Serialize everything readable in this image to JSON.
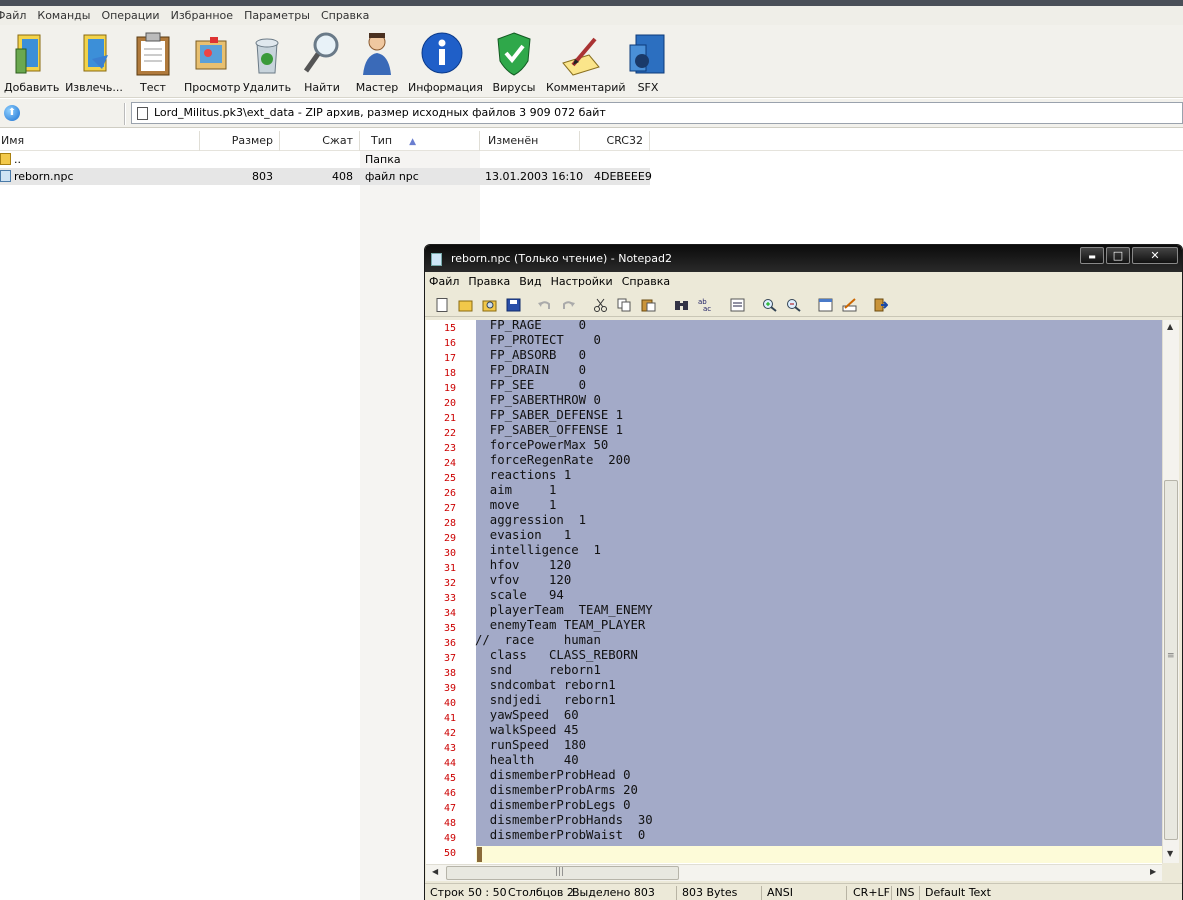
{
  "menu": [
    "Файл",
    "Команды",
    "Операции",
    "Избранное",
    "Параметры",
    "Справка"
  ],
  "toolbar": [
    {
      "label": "Добавить",
      "icon": "add-icon"
    },
    {
      "label": "Извлечь...",
      "icon": "extract-icon"
    },
    {
      "label": "Тест",
      "icon": "test-icon"
    },
    {
      "label": "Просмотр",
      "icon": "view-icon"
    },
    {
      "label": "Удалить",
      "icon": "delete-icon"
    },
    {
      "label": "Найти",
      "icon": "find-icon"
    },
    {
      "label": "Мастер",
      "icon": "wizard-icon"
    },
    {
      "label": "Информация",
      "icon": "info-icon"
    },
    {
      "label": "Вирусы",
      "icon": "virus-scan-icon"
    },
    {
      "label": "Комментарий",
      "icon": "comment-icon"
    },
    {
      "label": "SFX",
      "icon": "sfx-icon"
    }
  ],
  "address": "Lord_Militus.pk3\\ext_data - ZIP архив, размер исходных файлов 3 909 072 байт",
  "columns": {
    "name": "Имя",
    "size": "Размер",
    "packed": "Сжат",
    "type": "Тип",
    "modified": "Изменён",
    "crc": "CRC32"
  },
  "files": [
    {
      "name": "..",
      "size": "",
      "packed": "",
      "type": "Папка",
      "modified": "",
      "crc": ""
    },
    {
      "name": "reborn.npc",
      "size": "803",
      "packed": "408",
      "type": "файл npc",
      "modified": "13.01.2003 16:10",
      "crc": "4DEBEEE9"
    }
  ],
  "notepad": {
    "title": "reborn.npc (Только чтение) - Notepad2",
    "window_buttons": {
      "minimize": "▬",
      "maximize": "□",
      "close": "✕"
    },
    "menu": [
      "Файл",
      "Правка",
      "Вид",
      "Настройки",
      "Справка"
    ],
    "tools": [
      "new-icon",
      "open-icon",
      "browse-icon",
      "save-icon",
      "undo-icon",
      "redo-icon",
      "cut-icon",
      "copy-icon",
      "paste-icon",
      "find-icon",
      "replace-icon",
      "word-wrap-icon",
      "zoom-in-icon",
      "zoom-out-icon",
      "scheme-icon",
      "customize-icon",
      "exit-icon"
    ],
    "lines": [
      {
        "n": "15",
        "text": "  FP_RAGE     0"
      },
      {
        "n": "16",
        "text": "  FP_PROTECT    0"
      },
      {
        "n": "17",
        "text": "  FP_ABSORB   0"
      },
      {
        "n": "18",
        "text": "  FP_DRAIN    0"
      },
      {
        "n": "19",
        "text": "  FP_SEE      0"
      },
      {
        "n": "20",
        "text": "  FP_SABERTHROW 0"
      },
      {
        "n": "21",
        "text": "  FP_SABER_DEFENSE 1"
      },
      {
        "n": "22",
        "text": "  FP_SABER_OFFENSE 1"
      },
      {
        "n": "23",
        "text": "  forcePowerMax 50"
      },
      {
        "n": "24",
        "text": "  forceRegenRate  200"
      },
      {
        "n": "25",
        "text": "  reactions 1"
      },
      {
        "n": "26",
        "text": "  aim     1"
      },
      {
        "n": "27",
        "text": "  move    1"
      },
      {
        "n": "28",
        "text": "  aggression  1"
      },
      {
        "n": "29",
        "text": "  evasion   1"
      },
      {
        "n": "30",
        "text": "  intelligence  1"
      },
      {
        "n": "31",
        "text": "  hfov    120"
      },
      {
        "n": "32",
        "text": "  vfov    120"
      },
      {
        "n": "33",
        "text": "  scale   94"
      },
      {
        "n": "34",
        "text": "  playerTeam  TEAM_ENEMY"
      },
      {
        "n": "35",
        "text": "  enemyTeam TEAM_PLAYER"
      },
      {
        "n": "36",
        "text": "//  race    human"
      },
      {
        "n": "37",
        "text": "  class   CLASS_REBORN"
      },
      {
        "n": "38",
        "text": "  snd     reborn1"
      },
      {
        "n": "39",
        "text": "  sndcombat reborn1"
      },
      {
        "n": "40",
        "text": "  sndjedi   reborn1"
      },
      {
        "n": "41",
        "text": "  yawSpeed  60"
      },
      {
        "n": "42",
        "text": "  walkSpeed 45"
      },
      {
        "n": "43",
        "text": "  runSpeed  180"
      },
      {
        "n": "44",
        "text": "  health    40"
      },
      {
        "n": "45",
        "text": "  dismemberProbHead 0"
      },
      {
        "n": "46",
        "text": "  dismemberProbArms 20"
      },
      {
        "n": "47",
        "text": "  dismemberProbLegs 0"
      },
      {
        "n": "48",
        "text": "  dismemberProbHands  30"
      },
      {
        "n": "49",
        "text": "  dismemberProbWaist  0"
      },
      {
        "n": "50",
        "text": ""
      }
    ],
    "hscroll_grip": "|||",
    "vscroll_grip": "≡",
    "status": {
      "pos": "Строк 50 : 50",
      "col": "Столбцов 2",
      "sel": "Выделено 803",
      "size": "803 Bytes",
      "enc": "ANSI",
      "eol": "CR+LF",
      "ins": "INS",
      "scheme": "Default Text"
    }
  },
  "colors": {
    "selection": "#a3aac8",
    "current_line": "#fdfbd8",
    "line_numbers": "#cc0000"
  }
}
